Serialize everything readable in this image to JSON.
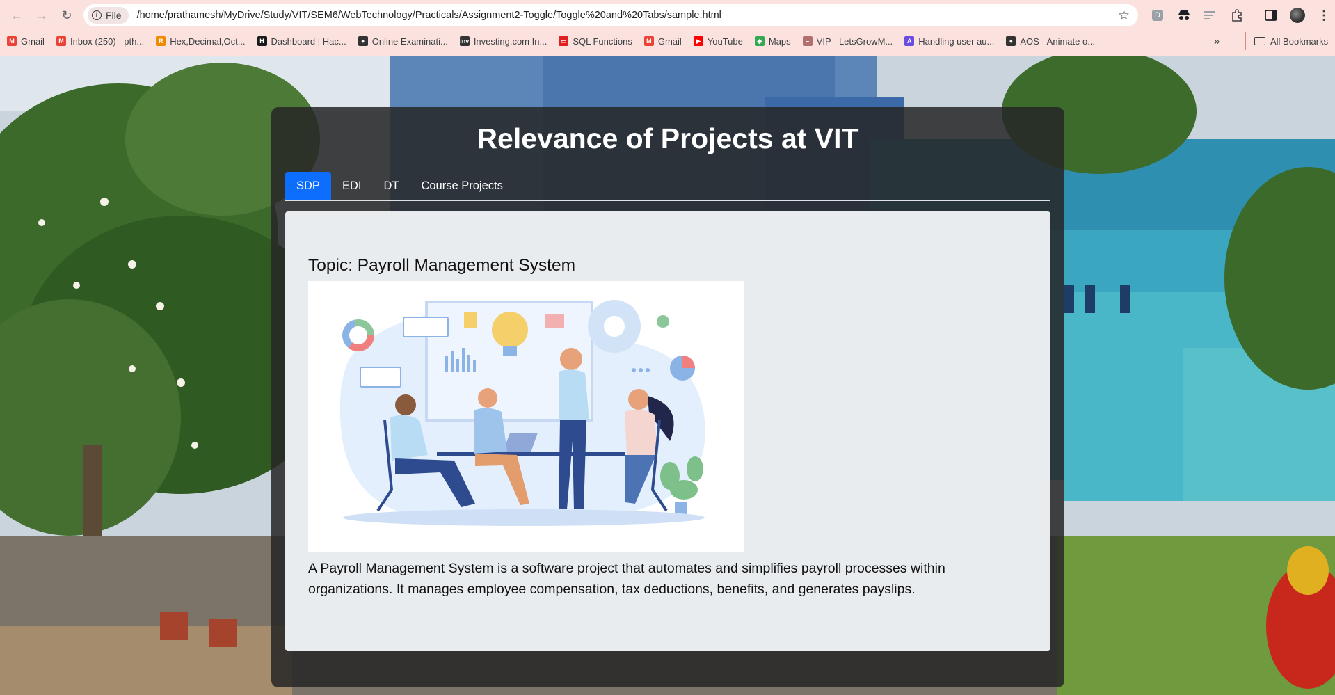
{
  "browser": {
    "url_chip": "File",
    "url": "/home/prathamesh/MyDrive/Study/VIT/SEM6/WebTechnology/Practicals/Assignment2-Toggle/Toggle%20and%20Tabs/sample.html",
    "bookmarks": [
      {
        "label": "Gmail",
        "icon": "gmail-icon",
        "color": "#ea4335"
      },
      {
        "label": "Inbox (250) - pth...",
        "icon": "gmail-icon",
        "color": "#ea4335"
      },
      {
        "label": "Hex,Decimal,Oct...",
        "icon": "r-logo-icon",
        "color": "#f08a00"
      },
      {
        "label": "Dashboard | Hac...",
        "icon": "hackerrank-icon",
        "color": "#1b1b1b"
      },
      {
        "label": "Online Examinati...",
        "icon": "globe-icon",
        "color": "#333333"
      },
      {
        "label": "Investing.com In...",
        "icon": "investing-icon",
        "color": "#333333"
      },
      {
        "label": "SQL Functions",
        "icon": "sql-icon",
        "color": "#e02020"
      },
      {
        "label": "Gmail",
        "icon": "gmail-icon",
        "color": "#ea4335"
      },
      {
        "label": "YouTube",
        "icon": "youtube-icon",
        "color": "#ff0000"
      },
      {
        "label": "Maps",
        "icon": "maps-pin-icon",
        "color": "#34a853"
      },
      {
        "label": "VIP - LetsGrowM...",
        "icon": "dash-icon",
        "color": "#b07070"
      },
      {
        "label": "Handling user au...",
        "icon": "auth-icon",
        "color": "#6a4ce0"
      },
      {
        "label": "AOS - Animate o...",
        "icon": "globe-icon",
        "color": "#333333"
      }
    ],
    "more_bookmarks": "»",
    "all_bookmarks": "All Bookmarks"
  },
  "page": {
    "title": "Relevance of Projects at VIT",
    "tabs": [
      {
        "label": "SDP",
        "active": true
      },
      {
        "label": "EDI",
        "active": false
      },
      {
        "label": "DT",
        "active": false
      },
      {
        "label": "Course Projects",
        "active": false
      }
    ],
    "panel": {
      "topic": "Topic: Payroll Management System",
      "description": "A Payroll Management System is a software project that automates and simplifies payroll processes within organizations. It manages employee compensation, tax deductions, benefits, and generates payslips."
    }
  },
  "colors": {
    "chrome_bg": "#fbe2de",
    "active_tab": "#0d6efd",
    "card_bg": "#262626",
    "panel_bg": "#e8ecef"
  }
}
